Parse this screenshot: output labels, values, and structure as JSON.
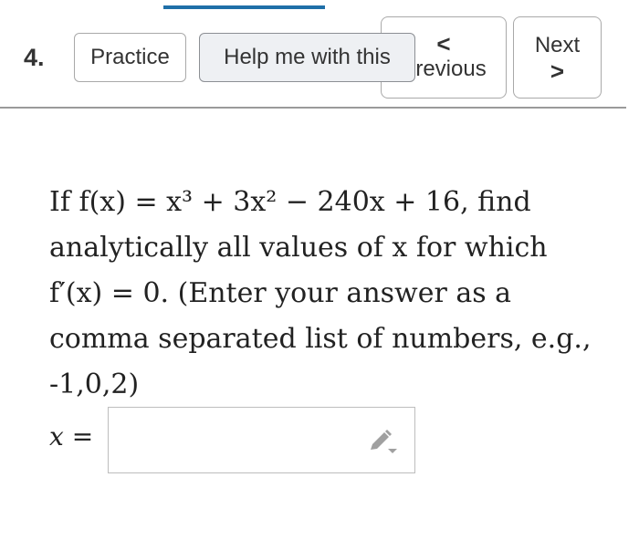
{
  "question_number": "4.",
  "toolbar": {
    "practice_label": "Practice",
    "help_label": "Help me with this",
    "previous_label": "Previous",
    "previous_chevron": "<",
    "next_label": "Next",
    "next_chevron": ">"
  },
  "question": {
    "line1": "If f(x) = x³ + 3x² − 240x + 16, find",
    "line2": "analytically all values of x for which",
    "line3": "f′(x) = 0. (Enter your answer as a",
    "line4": "comma separated list of numbers, e.g.,",
    "line5": "-1,0,2)"
  },
  "answer": {
    "label": "x =",
    "value": ""
  },
  "colors": {
    "accent": "#1f6fa8",
    "button_border": "#a9a9a9",
    "help_bg": "#eef0f3",
    "pencil_gray": "#a0a0a0"
  },
  "icons": {
    "answer_tool": "pencil-icon"
  }
}
